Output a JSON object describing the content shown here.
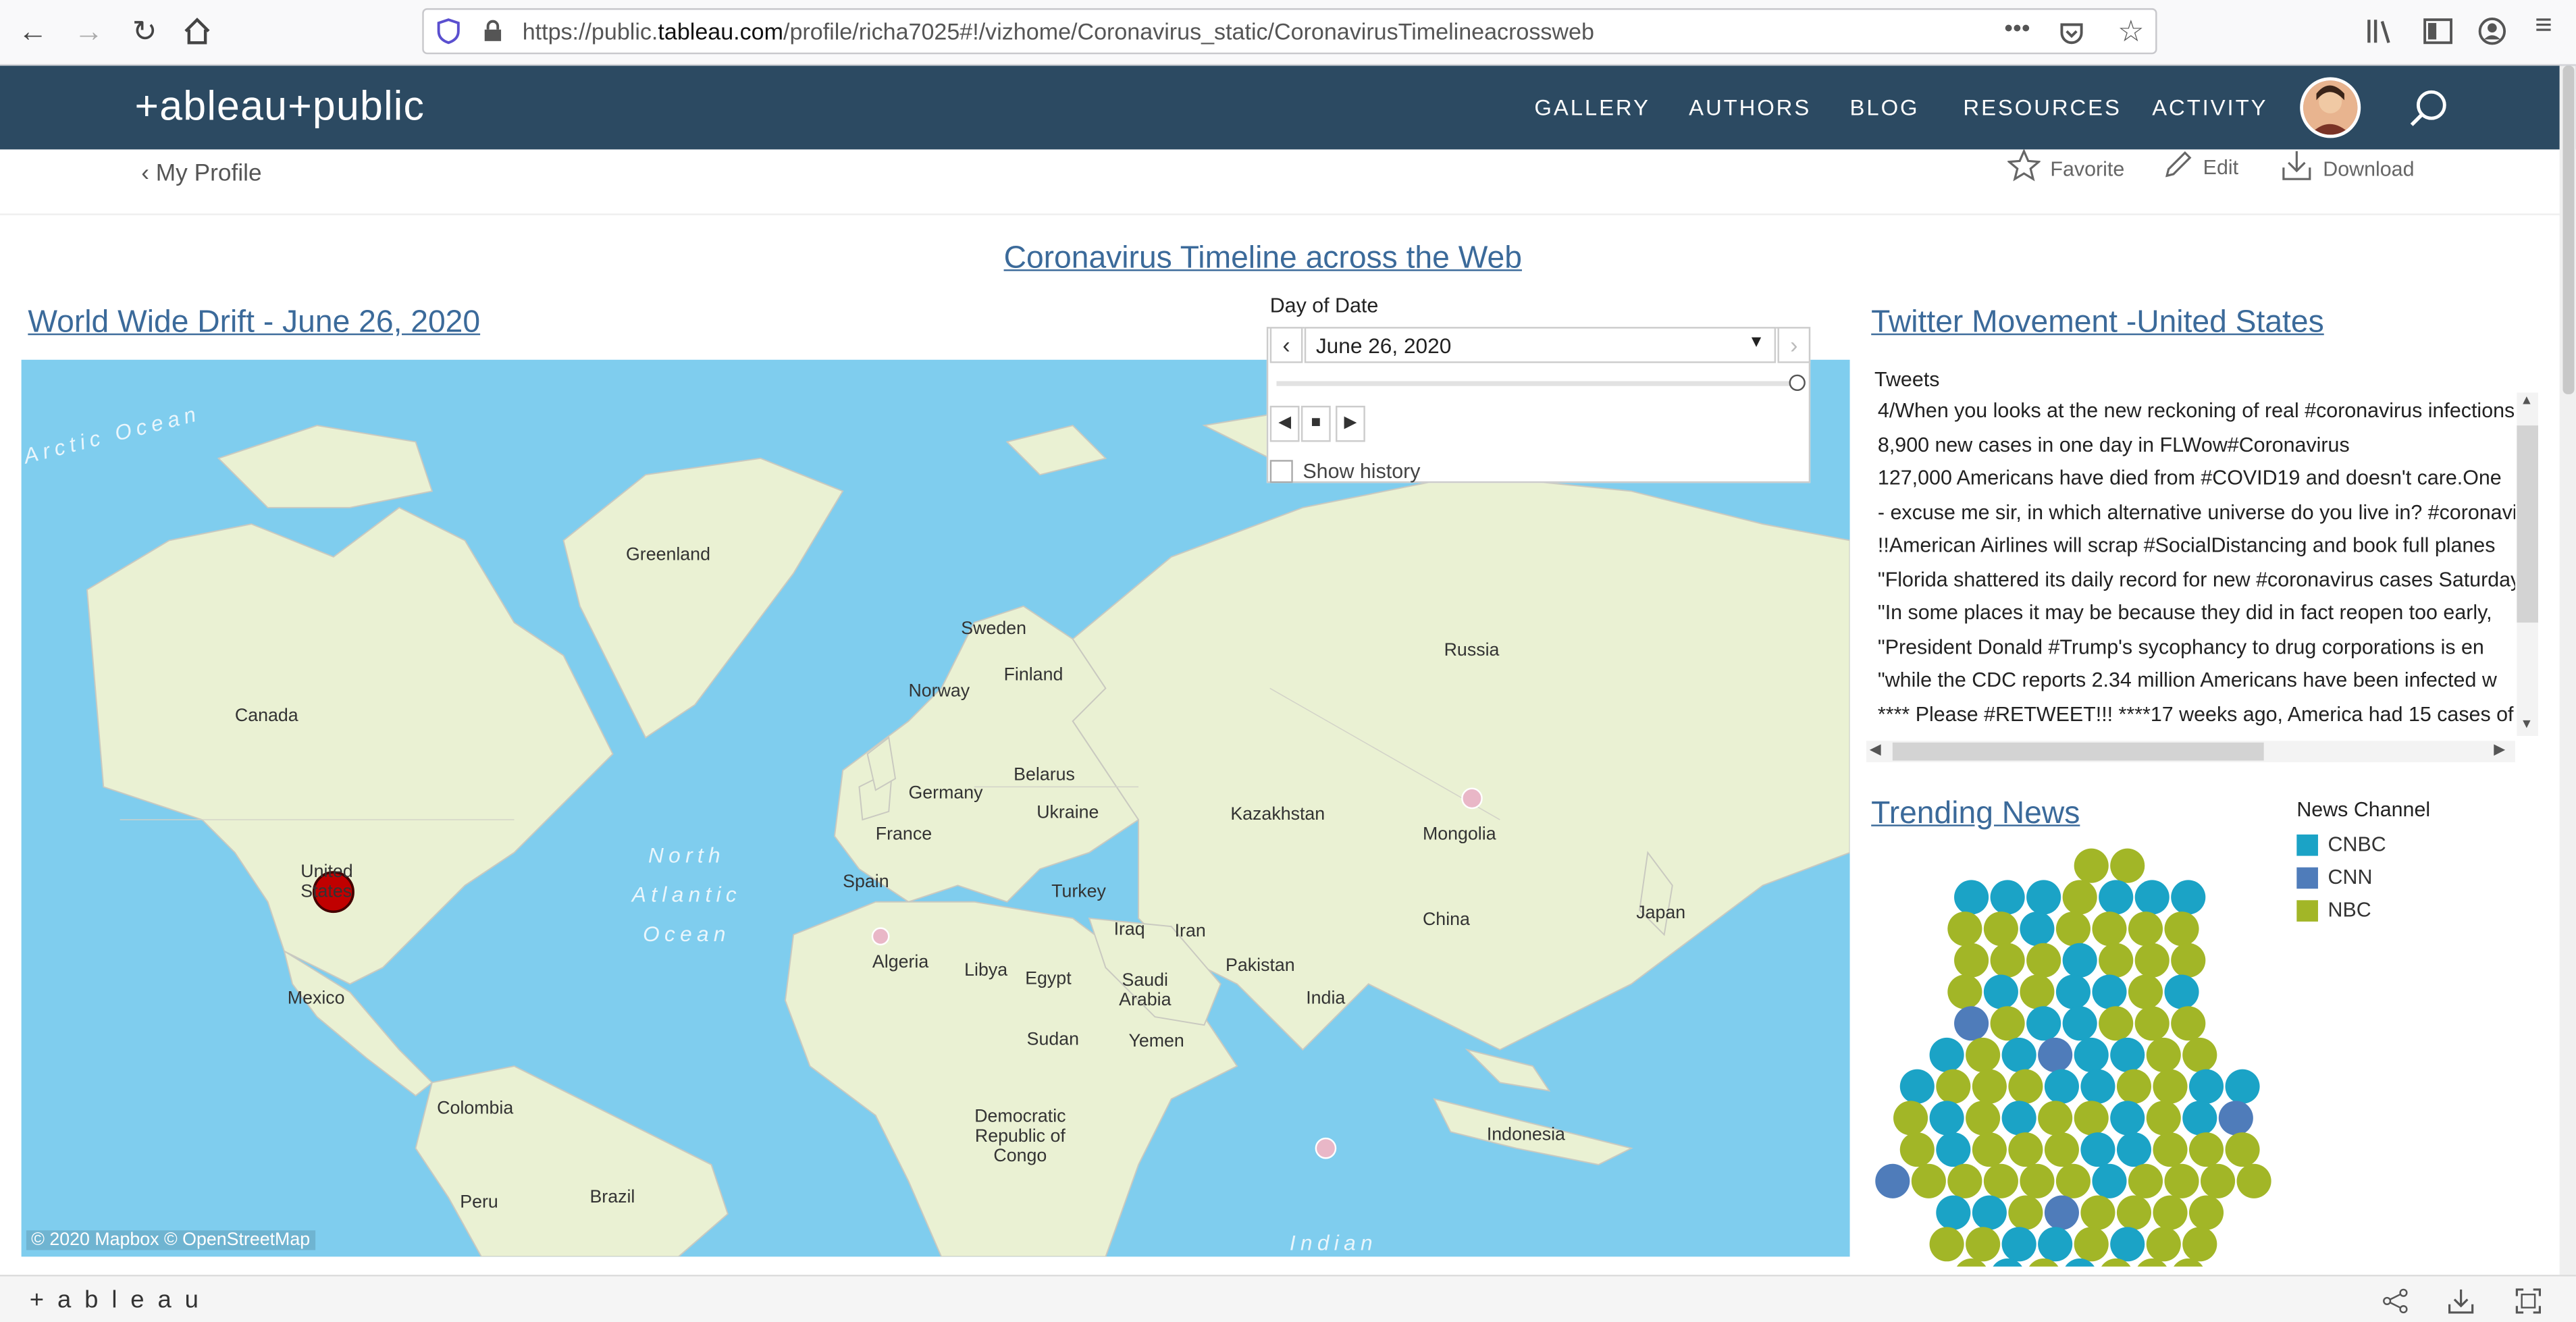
{
  "browser": {
    "url_prefix": "https://public.",
    "url_domain": "tableau.com",
    "url_path": "/profile/richa7025#!/vizhome/Coronavirus_static/CoronavirusTimelineacrossweb",
    "overflow": "•••"
  },
  "header": {
    "logo": "+ableau+public",
    "nav": [
      "GALLERY",
      "AUTHORS",
      "BLOG",
      "RESOURCES",
      "ACTIVITY"
    ]
  },
  "subbar": {
    "back_label": "My Profile",
    "favorite": "Favorite",
    "edit": "Edit",
    "download": "Download"
  },
  "viz": {
    "main_title": "Coronavirus Timeline across the Web",
    "map_title": "World Wide Drift - June 26, 2020",
    "filter_label": "Day of Date",
    "filter_value": "June 26, 2020",
    "show_history": "Show history",
    "attribution": "© 2020 Mapbox  © OpenStreetMap",
    "map_labels": {
      "greenland": "Greenland",
      "canada": "Canada",
      "us": "United States",
      "mexico": "Mexico",
      "colombia": "Colombia",
      "peru": "Peru",
      "brazil": "Brazil",
      "sweden": "Sweden",
      "norway": "Norway",
      "finland": "Finland",
      "russia": "Russia",
      "belarus": "Belarus",
      "germany": "Germany",
      "ukraine": "Ukraine",
      "france": "France",
      "spain": "Spain",
      "turkey": "Turkey",
      "kazakhstan": "Kazakhstan",
      "mongolia": "Mongolia",
      "china": "China",
      "japan": "Japan",
      "iraq": "Iraq",
      "iran": "Iran",
      "pakistan": "Pakistan",
      "india": "India",
      "algeria": "Algeria",
      "libya": "Libya",
      "egypt": "Egypt",
      "saudi": "Saudi Arabia",
      "sudan": "Sudan",
      "yemen": "Yemen",
      "drc": "Democratic Republic of Congo",
      "indonesia": "Indonesia",
      "ocean_atl": "North Atlantic Ocean",
      "ocean_arc": "Arctic Ocean",
      "ocean_ind": "Indian"
    },
    "twitter_title": "Twitter Movement -United States",
    "tweets_header": "Tweets",
    "tweets": [
      "4/When you looks at the new  reckoning of real #coronavirus infections",
      "8,900 new cases in one day in FLWow#Coronavirus",
      "127,000 Americans have died from #COVID19 and  doesn't care.One",
      "- excuse me sir, in which alternative universe do you live in? #coronavirus",
      "!!American Airlines will scrap #SocialDistancing and book full planes",
      "\"Florida shattered its daily record for new #coronavirus cases Saturday",
      "\"In some places it may be because they did in fact reopen too early,",
      "\"President Donald #Trump's sycophancy to drug corporations is en",
      "\"while the CDC reports 2.34 million Americans have been infected w",
      "**** Please #RETWEET!!! ****17 weeks ago, America had 15 cases of"
    ],
    "news_title": "Trending News",
    "legend_title": "News Channel",
    "legend": [
      {
        "label": "CNBC",
        "color": "#1ba3c6"
      },
      {
        "label": "CNN",
        "color": "#4f7cba"
      },
      {
        "label": "NBC",
        "color": "#a2b627"
      }
    ],
    "bubbles": "xxNN|CCCNCCC|NNCNNNN|NNNCNNN|NCNCCNC|CNCCNNN|CNCCCCNN|CNNNCCNNCC|NCNCNNCNCC|NCNNNCCNNN|CNNNNNCNNNN|CCNCNNNN|NNCCNCNN|NCNCNNN|CCCNNNC|NNCNNNN|CC"
  },
  "footer": {
    "brand": "+ a b l e a u"
  },
  "colors": {
    "header_bg": "#2c4a62",
    "title_blue": "#3b6a9a",
    "ocean": "#7fcdee",
    "land": "#eaf1d3",
    "us_dot": "#c00000"
  }
}
